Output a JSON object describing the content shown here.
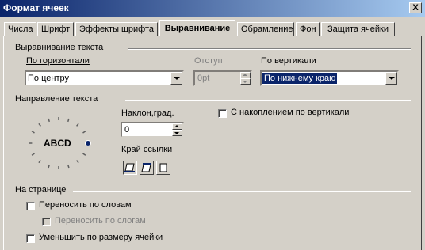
{
  "window": {
    "title": "Формат ячеек",
    "close_glyph": "X"
  },
  "tabs": [
    {
      "label": "Числа"
    },
    {
      "label": "Шрифт"
    },
    {
      "label": "Эффекты шрифта"
    },
    {
      "label": "Выравнивание",
      "active": true
    },
    {
      "label": "Обрамление"
    },
    {
      "label": "Фон"
    },
    {
      "label": "Защита ячейки"
    }
  ],
  "alignment": {
    "section_title": "Выравнивание текста",
    "horizontal": {
      "label": "По горизонтали",
      "value": "По центру"
    },
    "indent": {
      "label": "Отступ",
      "value": "0pt",
      "enabled": false
    },
    "vertical": {
      "label": "По вертикали",
      "value": "По нижнему краю"
    }
  },
  "direction": {
    "section_title": "Направление текста",
    "dial_text": "ABCD",
    "angle": {
      "label": "Наклон,град.",
      "value": "0"
    },
    "stacked": {
      "label": "С накоплением по вертикали",
      "checked": false
    },
    "edge": {
      "label": "Край ссылки",
      "selected": 0
    }
  },
  "on_page": {
    "section_title": "На странице",
    "wrap": {
      "label": "Переносить по словам",
      "checked": false
    },
    "hyphen": {
      "label": "Переносить по слогам",
      "checked": false,
      "enabled": false
    },
    "shrink": {
      "label": "Уменьшить по размеру ячейки",
      "checked": false
    }
  },
  "colors": {
    "title_start": "#0a246a",
    "title_end": "#a6caf0",
    "face": "#d4d0c8",
    "selection": "#0a246a",
    "dial_knob": "#0a246a"
  }
}
